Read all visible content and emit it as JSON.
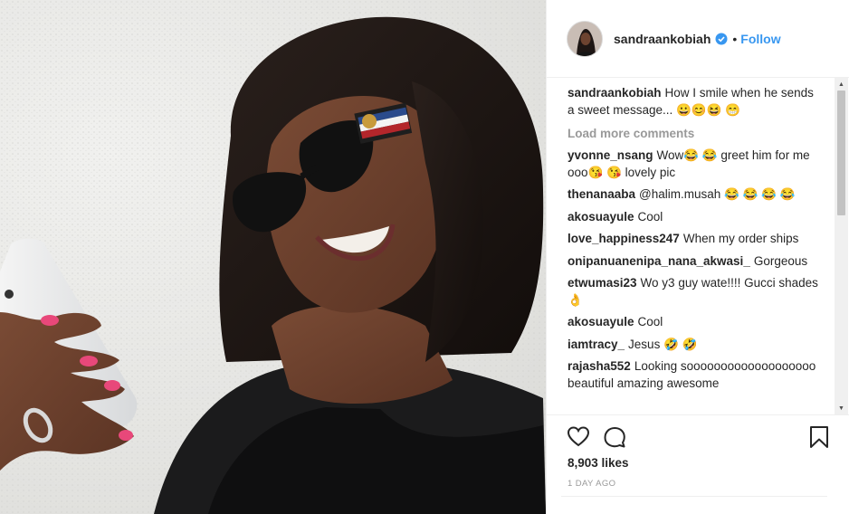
{
  "post": {
    "author": "sandraankobiah",
    "follow_label": "Follow",
    "separator": "•",
    "caption": "How I smile when he sends a sweet message... 😀😊😆 😁",
    "load_more_label": "Load more comments",
    "comments": [
      {
        "user": "yvonne_nsang",
        "text": "Wow😂 😂 greet him for me ooo😘 😘 lovely pic"
      },
      {
        "user": "thenanaaba",
        "text": "@halim.musah 😂 😂 😂 😂"
      },
      {
        "user": "akosuayule",
        "text": "Cool"
      },
      {
        "user": "love_happiness247",
        "text": "When my order ships"
      },
      {
        "user": "onipanuanenipa_nana_akwasi_",
        "text": "Gorgeous"
      },
      {
        "user": "etwumasi23",
        "text": "Wo y3 guy wate!!!! Gucci shades👌"
      },
      {
        "user": "akosuayule",
        "text": "Cool"
      },
      {
        "user": "iamtracy_",
        "text": "Jesus 🤣 🤣"
      },
      {
        "user": "rajasha552",
        "text": "Looking sooooooooooooooooooo beautiful amazing awesome"
      }
    ],
    "likes": "8,903 likes",
    "time": "1 DAY AGO"
  },
  "icons": {
    "like": "heart-icon",
    "comment": "comment-icon",
    "save": "bookmark-icon",
    "verified": "verified-badge-icon"
  },
  "colors": {
    "link": "#3897f0",
    "text": "#262626",
    "muted": "#999999",
    "border": "#efefef"
  }
}
